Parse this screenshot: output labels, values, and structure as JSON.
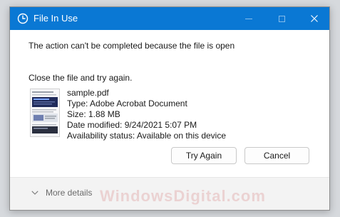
{
  "window": {
    "title": "File In Use",
    "icon": "clock-icon",
    "accent_color": "#0a78d4"
  },
  "dialog": {
    "message": "The action can't be completed because the file is open",
    "instruction": "Close the file and try again."
  },
  "file": {
    "name": "sample.pdf",
    "type": "Type: Adobe Acrobat Document",
    "size": "Size: 1.88 MB",
    "date_modified": "Date modified: 9/24/2021 5:07 PM",
    "availability": "Availability status: Available on this device"
  },
  "buttons": {
    "try_again": "Try Again",
    "cancel": "Cancel"
  },
  "footer": {
    "more_details": "More details"
  },
  "watermark": "WindowsDigital.com"
}
